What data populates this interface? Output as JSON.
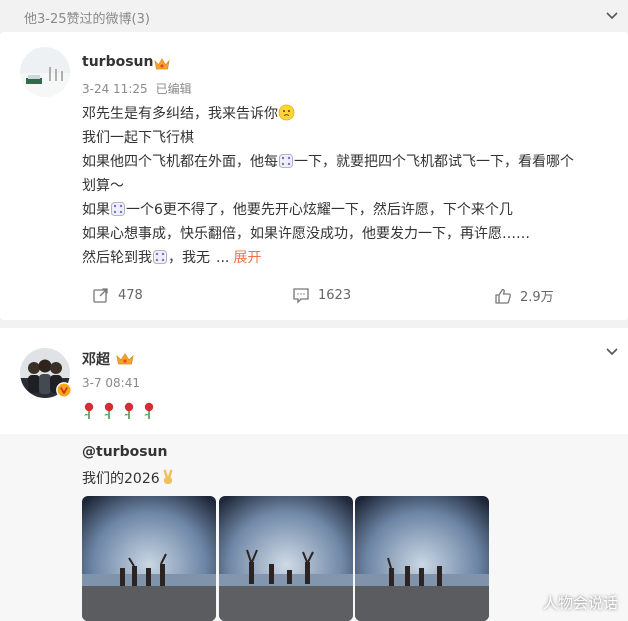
{
  "section": {
    "title": "他3-25赞过的微博(3)"
  },
  "posts": [
    {
      "username": "turbosun",
      "time": "3-24 11:25",
      "edited": "已编辑",
      "lines": {
        "l1": "邓先生是有多纠结，我来告诉你",
        "l2": "我们一起下飞行棋",
        "l3a": "如果他四个飞机都在外面，他每",
        "l3b": "一下，就要把四个飞机都试飞一下，看看哪个",
        "l4": "划算～",
        "l5a": "如果",
        "l5b": "一个6更不得了，他要先开心炫耀一下，然后许愿，下个来个几",
        "l6": "如果心想事成，快乐翻倍，如果许愿没成功，他要发力一下，再许愿……",
        "l7a": "然后轮到我",
        "l7b": "，我无",
        "l7c": "...",
        "expand": "展开"
      },
      "actions": {
        "repost": "478",
        "comment": "1623",
        "like": "2.9万"
      }
    },
    {
      "username": "邓超",
      "time": "3-7 08:41",
      "retweet": {
        "user": "@turbosun",
        "text": "我们的2026"
      }
    }
  ],
  "watermark": "人物会说话",
  "colors": {
    "accent": "#eb7350",
    "meta": "#8a8a8a",
    "background": "#f2f2f2"
  }
}
